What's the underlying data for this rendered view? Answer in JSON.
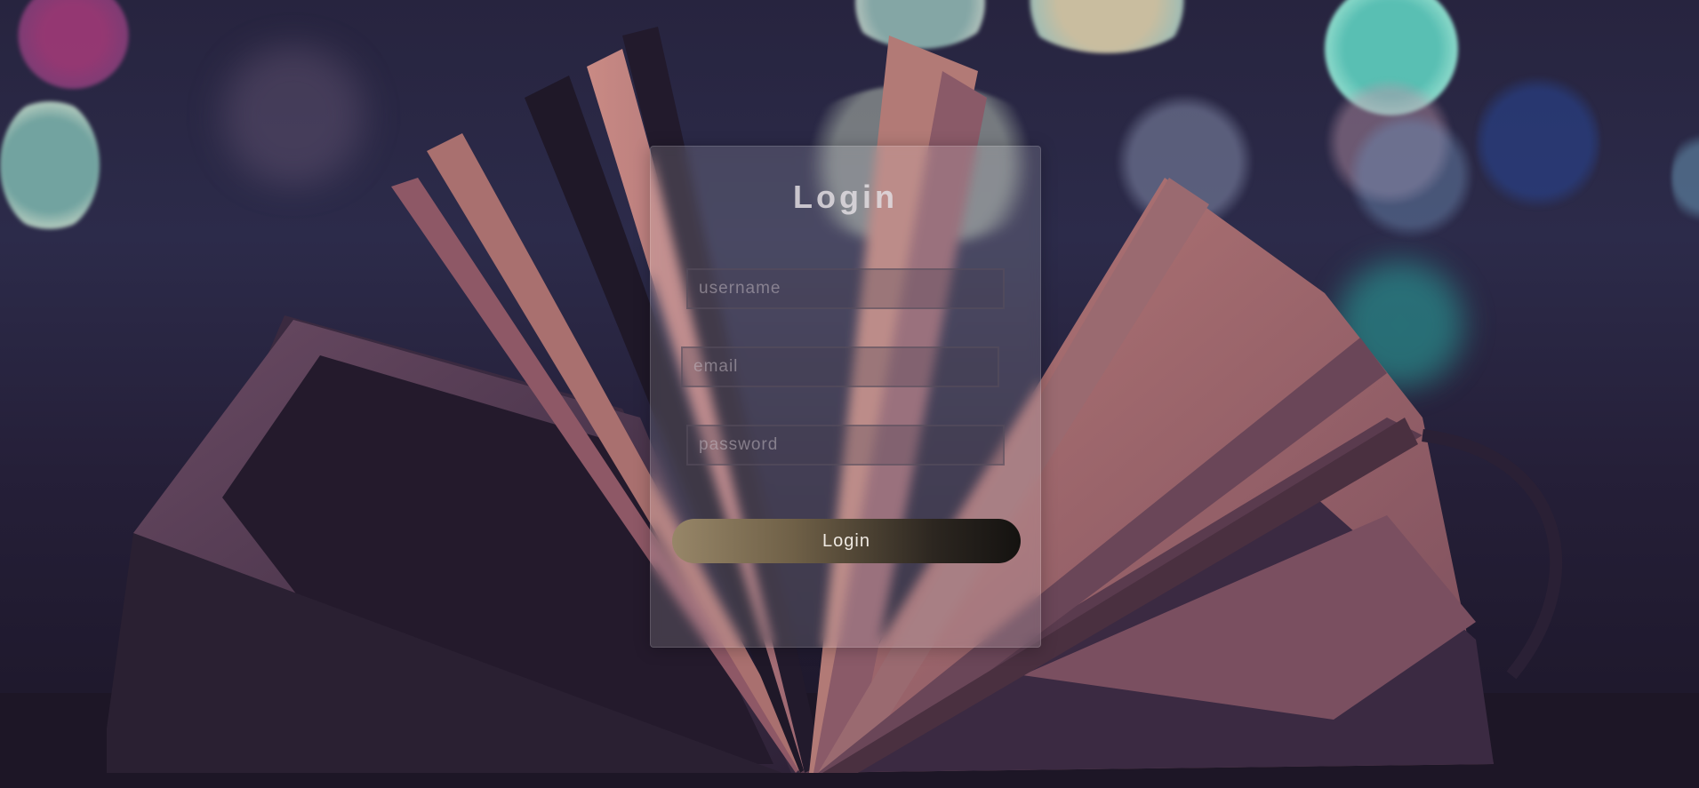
{
  "login_form": {
    "title": "Login",
    "username_placeholder": "username",
    "email_placeholder": "email",
    "password_placeholder": "password",
    "submit_label": "Login"
  },
  "theme": {
    "background": "#27243f",
    "button_gradient_start": "#978668",
    "button_gradient_end": "#141210"
  }
}
